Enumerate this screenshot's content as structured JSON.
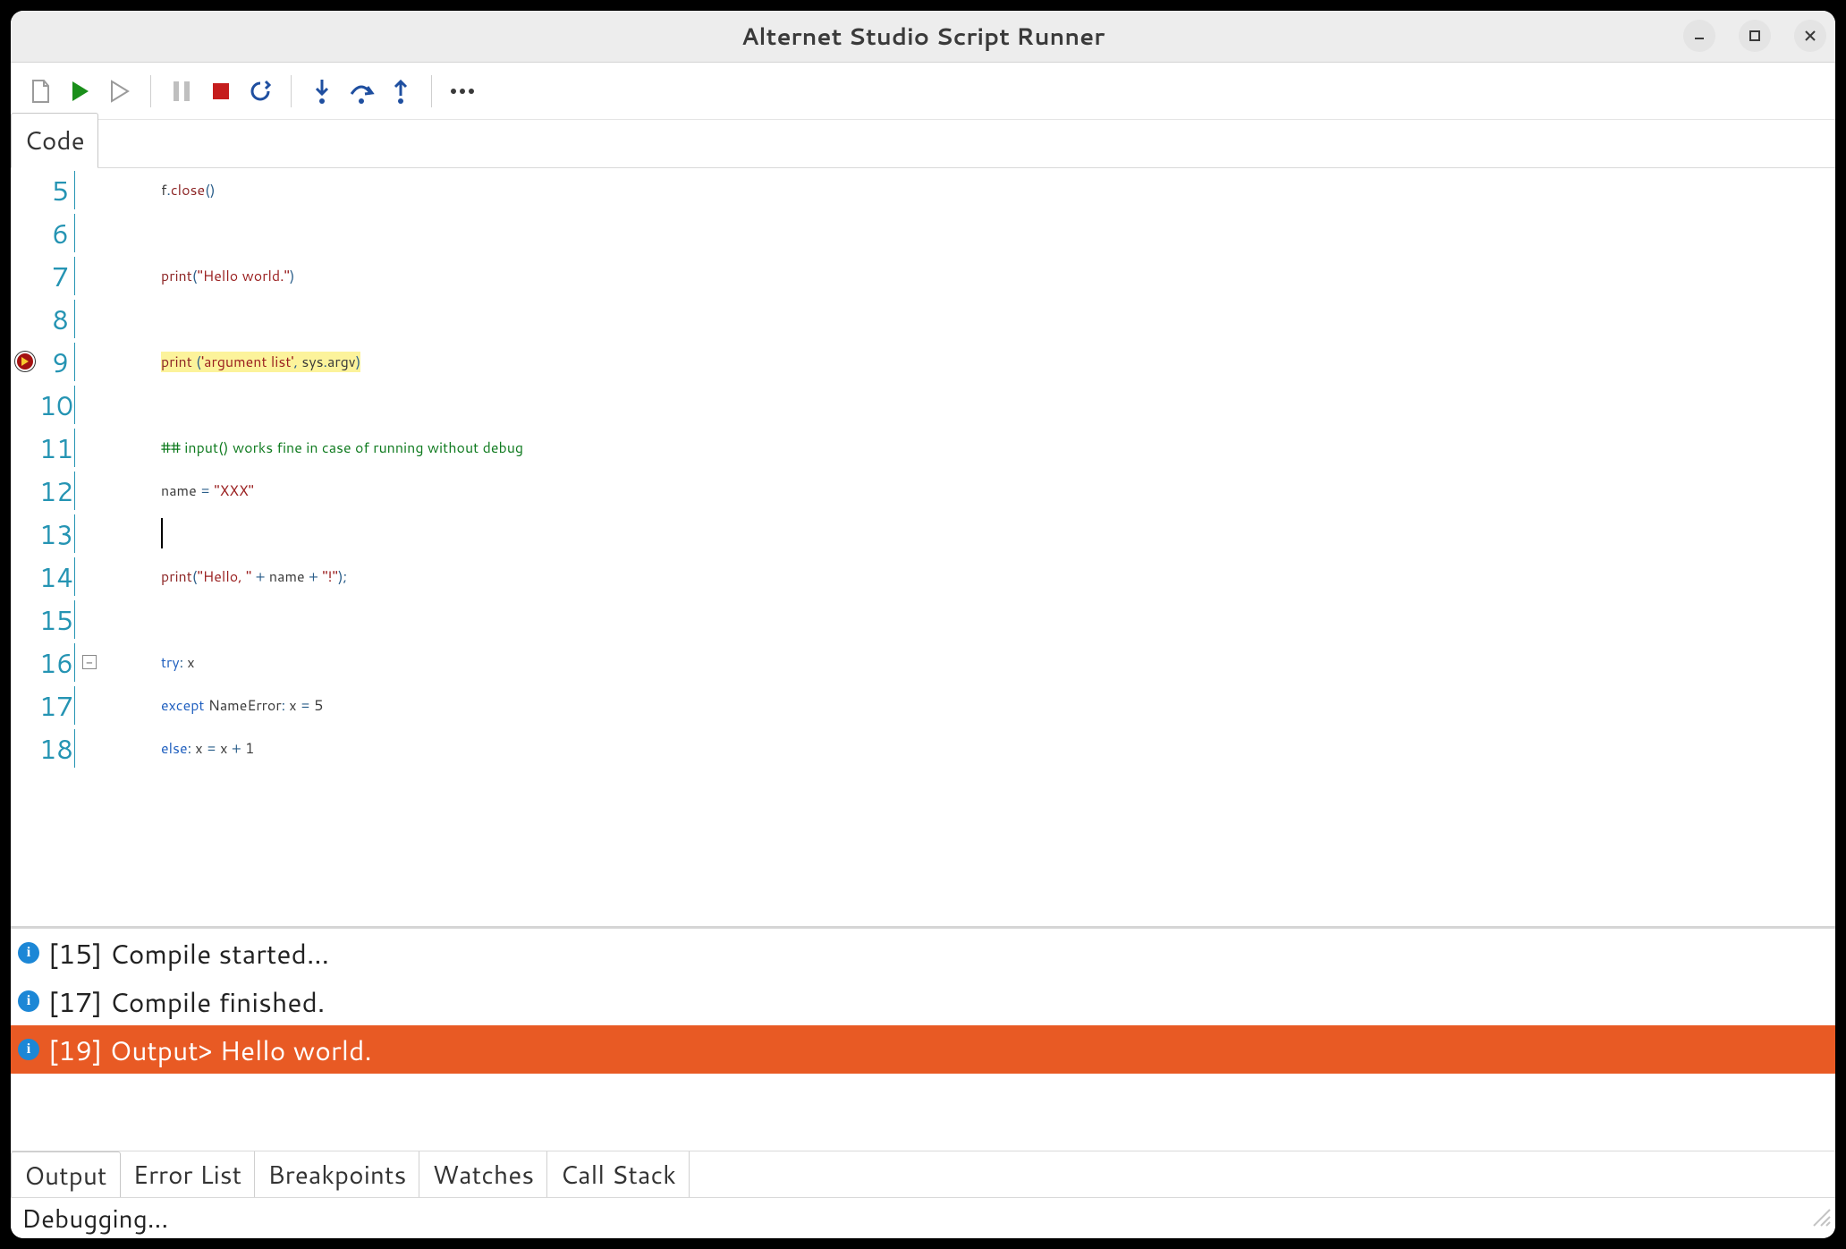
{
  "window": {
    "title": "Alternet Studio Script Runner"
  },
  "toolbar": {
    "items": [
      {
        "name": "new-file-icon"
      },
      {
        "name": "run-icon"
      },
      {
        "name": "run-outline-icon"
      },
      {
        "sep": true
      },
      {
        "name": "pause-icon"
      },
      {
        "name": "stop-icon"
      },
      {
        "name": "restart-icon"
      },
      {
        "sep": true
      },
      {
        "name": "step-into-icon"
      },
      {
        "name": "step-over-icon"
      },
      {
        "name": "step-out-icon"
      },
      {
        "sep": true
      },
      {
        "name": "more-icon"
      }
    ]
  },
  "tabs": {
    "active": "Code"
  },
  "code": {
    "lines": [
      {
        "n": 5,
        "tokens": [
          {
            "t": "f",
            "c": "ident"
          },
          {
            "t": ".",
            "c": "punct"
          },
          {
            "t": "close",
            "c": "func"
          },
          {
            "t": "()",
            "c": "punct"
          }
        ]
      },
      {
        "n": 6,
        "tokens": []
      },
      {
        "n": 7,
        "tokens": [
          {
            "t": "print",
            "c": "func"
          },
          {
            "t": "(",
            "c": "punct"
          },
          {
            "t": "\"Hello world.\"",
            "c": "str"
          },
          {
            "t": ")",
            "c": "punct"
          }
        ]
      },
      {
        "n": 8,
        "tokens": []
      },
      {
        "n": 9,
        "bp": true,
        "hl": true,
        "tokens": [
          {
            "t": "print",
            "c": "func"
          },
          {
            "t": " (",
            "c": "punct"
          },
          {
            "t": "'argument list'",
            "c": "str"
          },
          {
            "t": ", ",
            "c": "punct"
          },
          {
            "t": "sys",
            "c": "ident"
          },
          {
            "t": ".",
            "c": "punct"
          },
          {
            "t": "argv",
            "c": "ident"
          },
          {
            "t": ")",
            "c": "punct"
          }
        ]
      },
      {
        "n": 10,
        "tokens": []
      },
      {
        "n": 11,
        "tokens": [
          {
            "t": "## input() works fine in case of running without debug",
            "c": "comment"
          }
        ]
      },
      {
        "n": 12,
        "tokens": [
          {
            "t": "name ",
            "c": "ident"
          },
          {
            "t": "= ",
            "c": "punct"
          },
          {
            "t": "\"XXX\"",
            "c": "str"
          }
        ]
      },
      {
        "n": 13,
        "cursor": true,
        "tokens": []
      },
      {
        "n": 14,
        "tokens": [
          {
            "t": "print",
            "c": "func"
          },
          {
            "t": "(",
            "c": "punct"
          },
          {
            "t": "\"Hello, \"",
            "c": "str"
          },
          {
            "t": " + ",
            "c": "punct"
          },
          {
            "t": "name",
            "c": "ident"
          },
          {
            "t": " + ",
            "c": "punct"
          },
          {
            "t": "\"!\"",
            "c": "str"
          },
          {
            "t": ");",
            "c": "punct"
          }
        ]
      },
      {
        "n": 15,
        "tokens": []
      },
      {
        "n": 16,
        "fold": "minus",
        "tokens": [
          {
            "t": "try",
            "c": "kw"
          },
          {
            "t": ": ",
            "c": "punct"
          },
          {
            "t": "x",
            "c": "ident"
          }
        ]
      },
      {
        "n": 17,
        "tokens": [
          {
            "t": "except",
            "c": "kw"
          },
          {
            "t": " ",
            "c": "ident"
          },
          {
            "t": "NameError",
            "c": "ident"
          },
          {
            "t": ": ",
            "c": "punct"
          },
          {
            "t": "x",
            "c": "ident"
          },
          {
            "t": " = ",
            "c": "punct"
          },
          {
            "t": "5",
            "c": "num"
          }
        ]
      },
      {
        "n": 18,
        "tokens": [
          {
            "t": "else",
            "c": "kw"
          },
          {
            "t": ": ",
            "c": "punct"
          },
          {
            "t": "x",
            "c": "ident"
          },
          {
            "t": " = ",
            "c": "punct"
          },
          {
            "t": "x",
            "c": "ident"
          },
          {
            "t": " + ",
            "c": "punct"
          },
          {
            "t": "1",
            "c": "num"
          }
        ]
      }
    ]
  },
  "output": {
    "rows": [
      {
        "text": "[15] Compile started...",
        "selected": false
      },
      {
        "text": "[17] Compile finished.",
        "selected": false
      },
      {
        "text": "[19] Output> Hello world.",
        "selected": true
      }
    ]
  },
  "bottom_tabs": {
    "items": [
      "Output",
      "Error List",
      "Breakpoints",
      "Watches",
      "Call Stack"
    ],
    "active": "Output"
  },
  "status": {
    "text": "Debugging..."
  }
}
